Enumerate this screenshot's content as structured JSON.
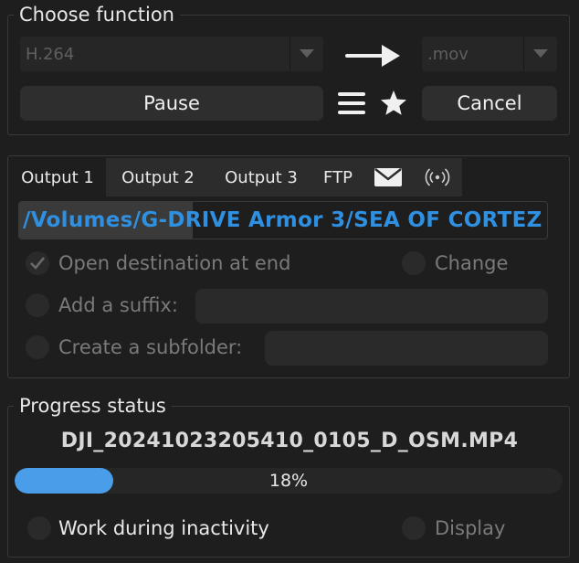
{
  "choose_function": {
    "title": "Choose function",
    "codec_value": "H.264",
    "container_value": ".mov",
    "pause_label": "Pause",
    "cancel_label": "Cancel"
  },
  "output": {
    "tabs": [
      {
        "label": "Output 1",
        "active": true
      },
      {
        "label": "Output 2",
        "active": false
      },
      {
        "label": "Output 3",
        "active": false
      },
      {
        "label": "FTP",
        "active": false
      }
    ],
    "tab_icons": [
      "envelope-icon",
      "broadcast-icon"
    ],
    "destination_path": "/Volumes/G-DRIVE Armor 3/SEA OF CORTEZ",
    "open_destination_label": "Open destination at end",
    "open_destination_checked": true,
    "change_label": "Change",
    "add_suffix_label": "Add a suffix:",
    "add_suffix_value": "",
    "create_subfolder_label": "Create a subfolder:",
    "create_subfolder_value": ""
  },
  "progress": {
    "title": "Progress status",
    "filename": "DJI_20241023205410_0105_D_OSM.MP4",
    "percent": 18,
    "percent_text": "18%",
    "work_inactivity_label": "Work during inactivity",
    "display_label": "Display"
  },
  "colors": {
    "background": "#1e1e1e",
    "accent": "#4a9de8",
    "path_text": "#2f8fe0"
  }
}
